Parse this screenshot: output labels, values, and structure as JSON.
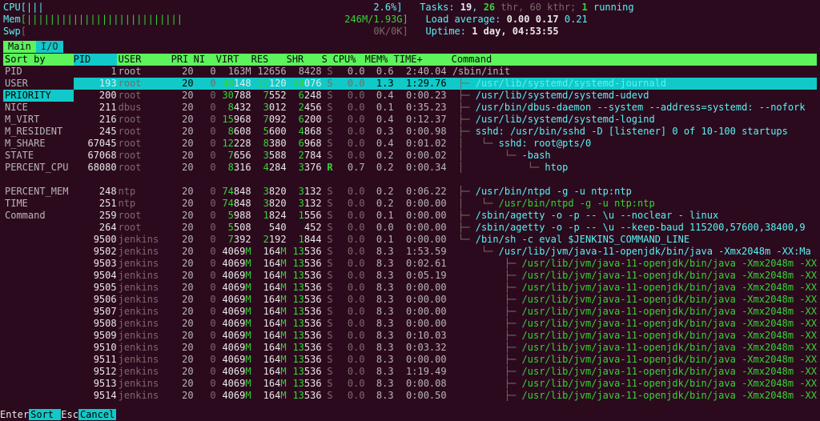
{
  "meters": {
    "cpu": {
      "label": "CPU",
      "bar": "[|||                                                         2.6%]"
    },
    "mem": {
      "label": "Mem",
      "bar": "[|||||||||||||||||||||||||||                            246M/1.93G]"
    },
    "swp": {
      "label": "Swp",
      "bar": "[                                                            0K/0K]"
    }
  },
  "stats": {
    "tasks_label": "Tasks: ",
    "tasks_procs": "19",
    "tasks_sep": ", ",
    "tasks_threads": "26",
    "tasks_rest": " thr, 60 kthr; ",
    "tasks_running": "1",
    "tasks_running_lbl": " running",
    "load_label": "Load average: ",
    "load1": "0.00",
    "load2": "0.17",
    "load3": "0.21",
    "uptime_label": "Uptime: ",
    "uptime": "1 day, 04:53:55"
  },
  "tabs": [
    "Main",
    "I/O"
  ],
  "sortby": {
    "title": "Sort by",
    "items": [
      "PID",
      "USER",
      "PRIORITY",
      "NICE",
      "M_VIRT",
      "M_RESIDENT",
      "M_SHARE",
      "STATE",
      "PERCENT_CPU",
      "",
      "PERCENT_MEM",
      "TIME",
      "Command"
    ],
    "selected": 2
  },
  "headers": {
    "pid": "PID",
    "user": "USER",
    "pri": "PRI",
    "ni": "NI",
    "virt": "VIRT",
    "res": "RES",
    "shr": "SHR",
    "s": "S",
    "cpu": "CPU%",
    "mem": "MEM%",
    "time": "TIME+",
    "cmd": "Command"
  },
  "rows": [
    {
      "pid": "1",
      "user": "root",
      "pri": "20",
      "ni": "0",
      "virt": "163M",
      "res": "12656",
      "shr": "8428",
      "s": "S",
      "cpu": "0.0",
      "mem": "0.6",
      "time": "2:40.04",
      "cmd": "/sbin/init",
      "tree": ""
    },
    {
      "pid": "193",
      "user": "root",
      "pri": "20",
      "ni": "0",
      "virt": "48148",
      "res": "27120",
      "shr": "24076",
      "s": "S",
      "cpu": "0.0",
      "mem": "1.3",
      "time": "1:29.76",
      "cmd": "/usr/lib/systemd/systemd-journald",
      "tree": " ├─ "
    },
    {
      "pid": "200",
      "user": "root",
      "pri": "20",
      "ni": "0",
      "virt": "30788",
      "res": "7552",
      "shr": "6248",
      "s": "S",
      "cpu": "0.0",
      "mem": "0.4",
      "time": "0:00.23",
      "cmd": "/usr/lib/systemd/systemd-udevd",
      "tree": " ├─ "
    },
    {
      "pid": "211",
      "user": "dbus",
      "pri": "20",
      "ni": "0",
      "virt": "8432",
      "res": "3012",
      "shr": "2456",
      "s": "S",
      "cpu": "0.0",
      "mem": "0.1",
      "time": "0:35.23",
      "cmd": "/usr/bin/dbus-daemon --system --address=systemd: --nofork",
      "tree": " ├─ "
    },
    {
      "pid": "216",
      "user": "root",
      "pri": "20",
      "ni": "0",
      "virt": "15968",
      "res": "7092",
      "shr": "6200",
      "s": "S",
      "cpu": "0.0",
      "mem": "0.4",
      "time": "0:12.37",
      "cmd": "/usr/lib/systemd/systemd-logind",
      "tree": " ├─ "
    },
    {
      "pid": "245",
      "user": "root",
      "pri": "20",
      "ni": "0",
      "virt": "8608",
      "res": "5600",
      "shr": "4868",
      "s": "S",
      "cpu": "0.0",
      "mem": "0.3",
      "time": "0:00.98",
      "cmd": "sshd: /usr/bin/sshd -D [listener] 0 of 10-100 startups",
      "tree": " ├─ "
    },
    {
      "pid": "67045",
      "user": "root",
      "pri": "20",
      "ni": "0",
      "virt": "12228",
      "res": "8380",
      "shr": "6968",
      "s": "S",
      "cpu": "0.0",
      "mem": "0.4",
      "time": "0:01.02",
      "cmd": "sshd: root@pts/0",
      "tree": " │   └─ "
    },
    {
      "pid": "67068",
      "user": "root",
      "pri": "20",
      "ni": "0",
      "virt": "7656",
      "res": "3588",
      "shr": "2784",
      "s": "S",
      "cpu": "0.0",
      "mem": "0.2",
      "time": "0:00.02",
      "cmd": "-bash",
      "tree": " │       └─ "
    },
    {
      "pid": "68080",
      "user": "root",
      "pri": "20",
      "ni": "0",
      "virt": "8316",
      "res": "4284",
      "shr": "3376",
      "s": "R",
      "cpu": "0.7",
      "mem": "0.2",
      "time": "0:00.34",
      "cmd": "htop",
      "tree": " │           └─ "
    },
    {
      "blank": true
    },
    {
      "pid": "248",
      "user": "ntp",
      "pri": "20",
      "ni": "0",
      "virt": "74848",
      "res": "3820",
      "shr": "3132",
      "s": "S",
      "cpu": "0.0",
      "mem": "0.2",
      "time": "0:06.22",
      "cmd": "/usr/bin/ntpd -g -u ntp:ntp",
      "tree": " ├─ "
    },
    {
      "pid": "251",
      "user": "ntp",
      "pri": "20",
      "ni": "0",
      "virt": "74848",
      "res": "3820",
      "shr": "3132",
      "s": "S",
      "cpu": "0.0",
      "mem": "0.2",
      "time": "0:00.00",
      "cmd": "/usr/bin/ntpd -g -u ntp:ntp",
      "tree": " │   └─ ",
      "thread": true
    },
    {
      "pid": "259",
      "user": "root",
      "pri": "20",
      "ni": "0",
      "virt": "5988",
      "res": "1824",
      "shr": "1556",
      "s": "S",
      "cpu": "0.0",
      "mem": "0.1",
      "time": "0:00.00",
      "cmd": "/sbin/agetty -o -p -- \\u --noclear - linux",
      "tree": " ├─ "
    },
    {
      "pid": "264",
      "user": "root",
      "pri": "20",
      "ni": "0",
      "virt": "5508",
      "res": "540",
      "shr": "452",
      "s": "S",
      "cpu": "0.0",
      "mem": "0.0",
      "time": "0:00.00",
      "cmd": "/sbin/agetty -o -p -- \\u --keep-baud 115200,57600,38400,9",
      "tree": " ├─ "
    },
    {
      "pid": "9500",
      "user": "jenkins",
      "pri": "20",
      "ni": "0",
      "virt": "7392",
      "res": "2192",
      "shr": "1844",
      "s": "S",
      "cpu": "0.0",
      "mem": "0.1",
      "time": "0:00.00",
      "cmd": "/bin/sh -c eval $JENKINS_COMMAND_LINE",
      "tree": " └─ "
    },
    {
      "pid": "9502",
      "user": "jenkins",
      "pri": "20",
      "ni": "0",
      "virt": "4069M",
      "res": "164M",
      "shr": "13536",
      "s": "S",
      "cpu": "0.0",
      "mem": "8.3",
      "time": "1:53.59",
      "cmd": "/usr/lib/jvm/java-11-openjdk/bin/java -Xmx2048m -XX:Ma",
      "tree": "     └─ "
    },
    {
      "pid": "9503",
      "user": "jenkins",
      "pri": "20",
      "ni": "0",
      "virt": "4069M",
      "res": "164M",
      "shr": "13536",
      "s": "S",
      "cpu": "0.0",
      "mem": "8.3",
      "time": "0:02.61",
      "cmd": "/usr/lib/jvm/java-11-openjdk/bin/java -Xmx2048m -XX",
      "tree": "         ├─ ",
      "thread": true
    },
    {
      "pid": "9504",
      "user": "jenkins",
      "pri": "20",
      "ni": "0",
      "virt": "4069M",
      "res": "164M",
      "shr": "13536",
      "s": "S",
      "cpu": "0.0",
      "mem": "8.3",
      "time": "0:05.19",
      "cmd": "/usr/lib/jvm/java-11-openjdk/bin/java -Xmx2048m -XX",
      "tree": "         ├─ ",
      "thread": true
    },
    {
      "pid": "9505",
      "user": "jenkins",
      "pri": "20",
      "ni": "0",
      "virt": "4069M",
      "res": "164M",
      "shr": "13536",
      "s": "S",
      "cpu": "0.0",
      "mem": "8.3",
      "time": "0:00.00",
      "cmd": "/usr/lib/jvm/java-11-openjdk/bin/java -Xmx2048m -XX",
      "tree": "         ├─ ",
      "thread": true
    },
    {
      "pid": "9506",
      "user": "jenkins",
      "pri": "20",
      "ni": "0",
      "virt": "4069M",
      "res": "164M",
      "shr": "13536",
      "s": "S",
      "cpu": "0.0",
      "mem": "8.3",
      "time": "0:00.00",
      "cmd": "/usr/lib/jvm/java-11-openjdk/bin/java -Xmx2048m -XX",
      "tree": "         ├─ ",
      "thread": true
    },
    {
      "pid": "9507",
      "user": "jenkins",
      "pri": "20",
      "ni": "0",
      "virt": "4069M",
      "res": "164M",
      "shr": "13536",
      "s": "S",
      "cpu": "0.0",
      "mem": "8.3",
      "time": "0:00.00",
      "cmd": "/usr/lib/jvm/java-11-openjdk/bin/java -Xmx2048m -XX",
      "tree": "         ├─ ",
      "thread": true
    },
    {
      "pid": "9508",
      "user": "jenkins",
      "pri": "20",
      "ni": "0",
      "virt": "4069M",
      "res": "164M",
      "shr": "13536",
      "s": "S",
      "cpu": "0.0",
      "mem": "8.3",
      "time": "0:00.00",
      "cmd": "/usr/lib/jvm/java-11-openjdk/bin/java -Xmx2048m -XX",
      "tree": "         ├─ ",
      "thread": true
    },
    {
      "pid": "9509",
      "user": "jenkins",
      "pri": "20",
      "ni": "0",
      "virt": "4069M",
      "res": "164M",
      "shr": "13536",
      "s": "S",
      "cpu": "0.0",
      "mem": "8.3",
      "time": "0:10.03",
      "cmd": "/usr/lib/jvm/java-11-openjdk/bin/java -Xmx2048m -XX",
      "tree": "         ├─ ",
      "thread": true
    },
    {
      "pid": "9510",
      "user": "jenkins",
      "pri": "20",
      "ni": "0",
      "virt": "4069M",
      "res": "164M",
      "shr": "13536",
      "s": "S",
      "cpu": "0.0",
      "mem": "8.3",
      "time": "0:03.32",
      "cmd": "/usr/lib/jvm/java-11-openjdk/bin/java -Xmx2048m -XX",
      "tree": "         ├─ ",
      "thread": true
    },
    {
      "pid": "9511",
      "user": "jenkins",
      "pri": "20",
      "ni": "0",
      "virt": "4069M",
      "res": "164M",
      "shr": "13536",
      "s": "S",
      "cpu": "0.0",
      "mem": "8.3",
      "time": "0:00.00",
      "cmd": "/usr/lib/jvm/java-11-openjdk/bin/java -Xmx2048m -XX",
      "tree": "         ├─ ",
      "thread": true
    },
    {
      "pid": "9512",
      "user": "jenkins",
      "pri": "20",
      "ni": "0",
      "virt": "4069M",
      "res": "164M",
      "shr": "13536",
      "s": "S",
      "cpu": "0.0",
      "mem": "8.3",
      "time": "1:19.49",
      "cmd": "/usr/lib/jvm/java-11-openjdk/bin/java -Xmx2048m -XX",
      "tree": "         ├─ ",
      "thread": true
    },
    {
      "pid": "9513",
      "user": "jenkins",
      "pri": "20",
      "ni": "0",
      "virt": "4069M",
      "res": "164M",
      "shr": "13536",
      "s": "S",
      "cpu": "0.0",
      "mem": "8.3",
      "time": "0:00.08",
      "cmd": "/usr/lib/jvm/java-11-openjdk/bin/java -Xmx2048m -XX",
      "tree": "         ├─ ",
      "thread": true
    },
    {
      "pid": "9514",
      "user": "jenkins",
      "pri": "20",
      "ni": "0",
      "virt": "4069M",
      "res": "164M",
      "shr": "13536",
      "s": "S",
      "cpu": "0.0",
      "mem": "8.3",
      "time": "0:00.50",
      "cmd": "/usr/lib/jvm/java-11-openjdk/bin/java -Xmx2048m -XX",
      "tree": "         ├─ ",
      "thread": true
    }
  ],
  "footer": {
    "enter": "Enter",
    "enter_lbl": "Sort   ",
    "esc": "Esc",
    "esc_lbl": "Cancel"
  }
}
